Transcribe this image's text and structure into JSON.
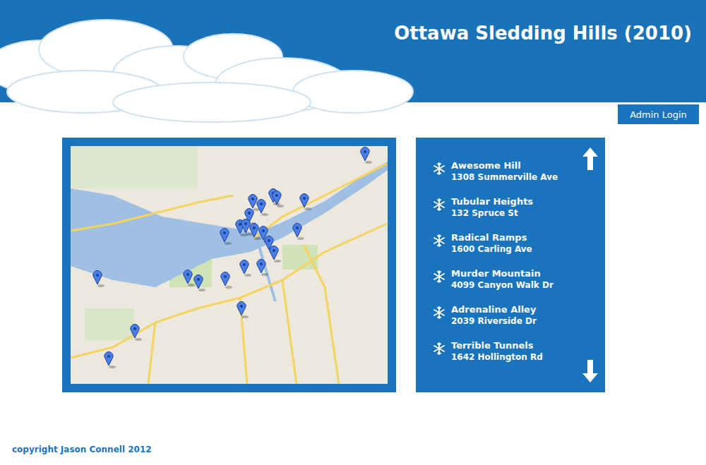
{
  "header": {
    "title": "Ottawa Sledding Hills (2010)"
  },
  "admin_button": {
    "label": "Admin Login"
  },
  "hills": [
    {
      "name": "Awesome Hill",
      "address": "1308 Summerville Ave"
    },
    {
      "name": "Tubular Heights",
      "address": "132 Spruce St"
    },
    {
      "name": "Radical Ramps",
      "address": "1600 Carling Ave"
    },
    {
      "name": "Murder Mountain",
      "address": "4099 Canyon Walk Dr"
    },
    {
      "name": "Adrenaline Alley",
      "address": "2039 Riverside Dr"
    },
    {
      "name": "Terrible Tunnels",
      "address": "1642 Hollington Rd"
    }
  ],
  "footer": {
    "copyright": "copyright Jason Connell 2012"
  }
}
